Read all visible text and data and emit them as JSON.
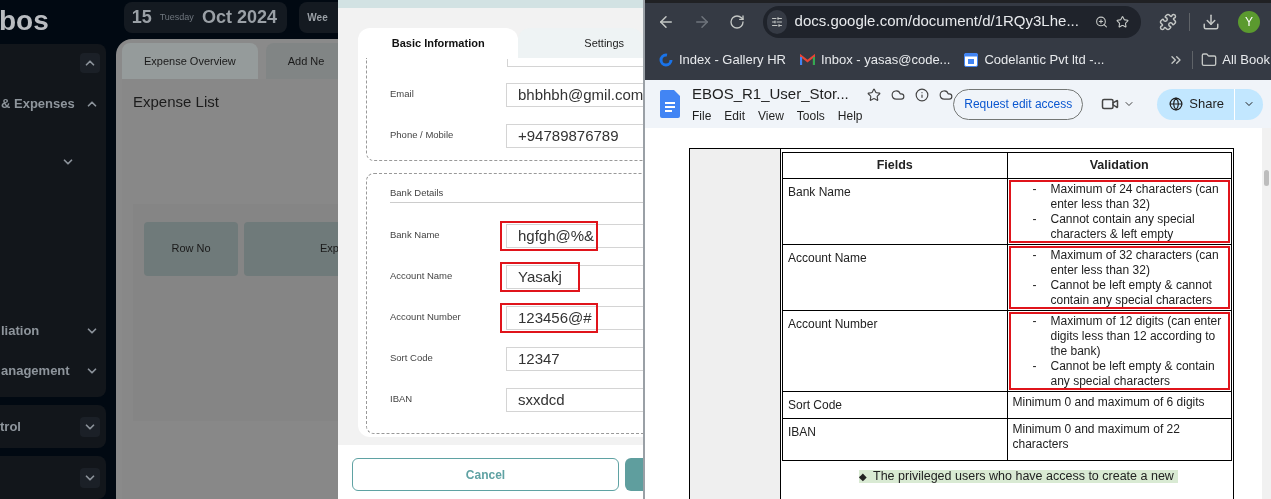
{
  "app": {
    "logo": "bos",
    "date": {
      "day": "15",
      "weekday": "Tuesday",
      "month_year": "Oct 2024"
    },
    "week_button": "Wee",
    "sidebar": {
      "items": [
        {
          "expanded": true
        },
        {
          "label": "& Expenses",
          "expanded": true
        },
        {
          "expanded": false
        },
        {
          "label": "liation",
          "expanded": false
        },
        {
          "label": "anagement",
          "expanded": false
        }
      ],
      "cards": [
        {
          "label": "trol",
          "expanded": false
        },
        {
          "expanded": false
        }
      ]
    },
    "tabs": [
      {
        "label": "Expense Overview",
        "selected": true
      },
      {
        "label": "Add Ne",
        "selected": false
      }
    ],
    "heading": "Expense List",
    "table": {
      "columns": [
        "Row No",
        "Exp"
      ]
    }
  },
  "modal": {
    "tabs": [
      {
        "label": "Basic Information",
        "selected": true
      },
      {
        "label": "Settings",
        "selected": false
      }
    ],
    "contact_fields": [
      {
        "label": "Email",
        "value": "bhbhbh@gmil.com",
        "annotated": false
      },
      {
        "label": "Phone / Mobile",
        "value": "+94789876789",
        "annotated": false
      }
    ],
    "bank_section": {
      "title": "Bank Details",
      "fields": [
        {
          "label": "Bank Name",
          "value": "hgfgh@%&",
          "annotated": true
        },
        {
          "label": "Account Name",
          "value": "Yasakj",
          "annotated": true
        },
        {
          "label": "Account Number",
          "value": "123456@#",
          "annotated": true
        },
        {
          "label": "Sort Code",
          "value": "12347",
          "annotated": false
        },
        {
          "label": "IBAN",
          "value": "sxxdcd",
          "annotated": false
        }
      ]
    },
    "buttons": {
      "cancel": "Cancel"
    }
  },
  "browser": {
    "url": "docs.google.com/document/d/1RQy3Lhe...",
    "profile_initial": "Y",
    "bookmarks": [
      {
        "label": "Index - Gallery HR",
        "kind": "gallery"
      },
      {
        "label": "Inbox - yasas@code...",
        "kind": "mail"
      },
      {
        "label": "Codelantic Pvt ltd -...",
        "kind": "calendar"
      }
    ],
    "all_bookmarks": "All Book",
    "doc": {
      "title": "EBOS_R1_User_Stor...",
      "menu": [
        "File",
        "Edit",
        "View",
        "Tools",
        "Help"
      ],
      "request_button": "Request edit access",
      "share_button": "Share",
      "table": {
        "columns": [
          "Fields",
          "Validation"
        ],
        "rows": [
          {
            "field": "Bank Name",
            "annotated": true,
            "validation": [
              {
                "marker": "-",
                "text": "Maximum of 24 characters (can enter less than 32)"
              },
              {
                "marker": "-",
                "text": "Cannot contain any special characters & left empty"
              }
            ]
          },
          {
            "field": "Account Name",
            "annotated": true,
            "validation": [
              {
                "marker": "-",
                "text": "Maximum of 32 characters (can enter less than 32)"
              },
              {
                "marker": "-",
                "text": "Cannot be left empty & cannot contain any special characters"
              }
            ]
          },
          {
            "field": "Account Number",
            "annotated": true,
            "validation": [
              {
                "marker": "-",
                "text": "Maximum of 12 digits (can enter digits less than 12 according to the bank)"
              },
              {
                "marker": "-",
                "text": "Cannot be left empty & contain any special characters"
              }
            ]
          },
          {
            "field": "Sort Code",
            "annotated": false,
            "validation": "Minimum 0 and maximum of 6 digits"
          },
          {
            "field": "IBAN",
            "annotated": false,
            "validation": "Minimum 0 and maximum of 22 characters"
          }
        ]
      },
      "bullet_mark": "◆",
      "bullet_text": "The privileged users who have access to create a new"
    }
  }
}
